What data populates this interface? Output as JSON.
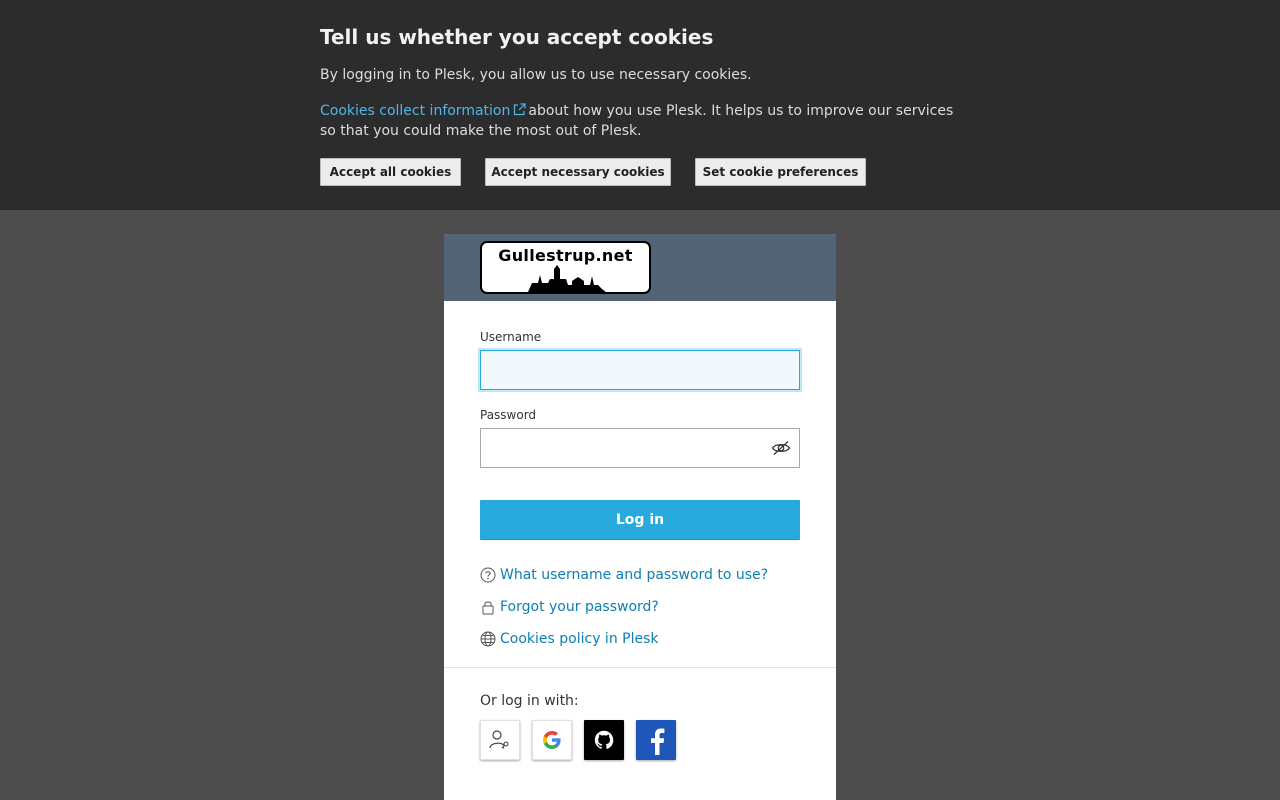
{
  "cookie_banner": {
    "title": "Tell us whether you accept cookies",
    "text1": "By logging in to Plesk, you allow us to use necessary cookies.",
    "link_text": "Cookies collect information",
    "text2_rest": "about how you use Plesk. It helps us to improve our services so that you could make the most out of Plesk.",
    "buttons": {
      "accept_all": "Accept all cookies",
      "accept_necessary": "Accept necessary cookies",
      "preferences": "Set cookie preferences"
    }
  },
  "login": {
    "logo_text": "Gullestrup.net",
    "username_label": "Username",
    "username_value": "",
    "password_label": "Password",
    "password_value": "",
    "submit_label": "Log in",
    "help_links": [
      {
        "icon": "question-circle-icon",
        "label": "What username and password to use?"
      },
      {
        "icon": "lock-icon",
        "label": "Forgot your password?"
      },
      {
        "icon": "globe-icon",
        "label": "Cookies policy in Plesk"
      }
    ],
    "alt_login_label": "Or log in with:",
    "social_providers": [
      "plesk-id",
      "google",
      "github",
      "facebook"
    ]
  },
  "colors": {
    "accent": "#28aade",
    "link": "#0d7fb3",
    "header": "#536477",
    "banner_bg": "#2c2c2c",
    "page_bg": "#4d4d4d"
  }
}
